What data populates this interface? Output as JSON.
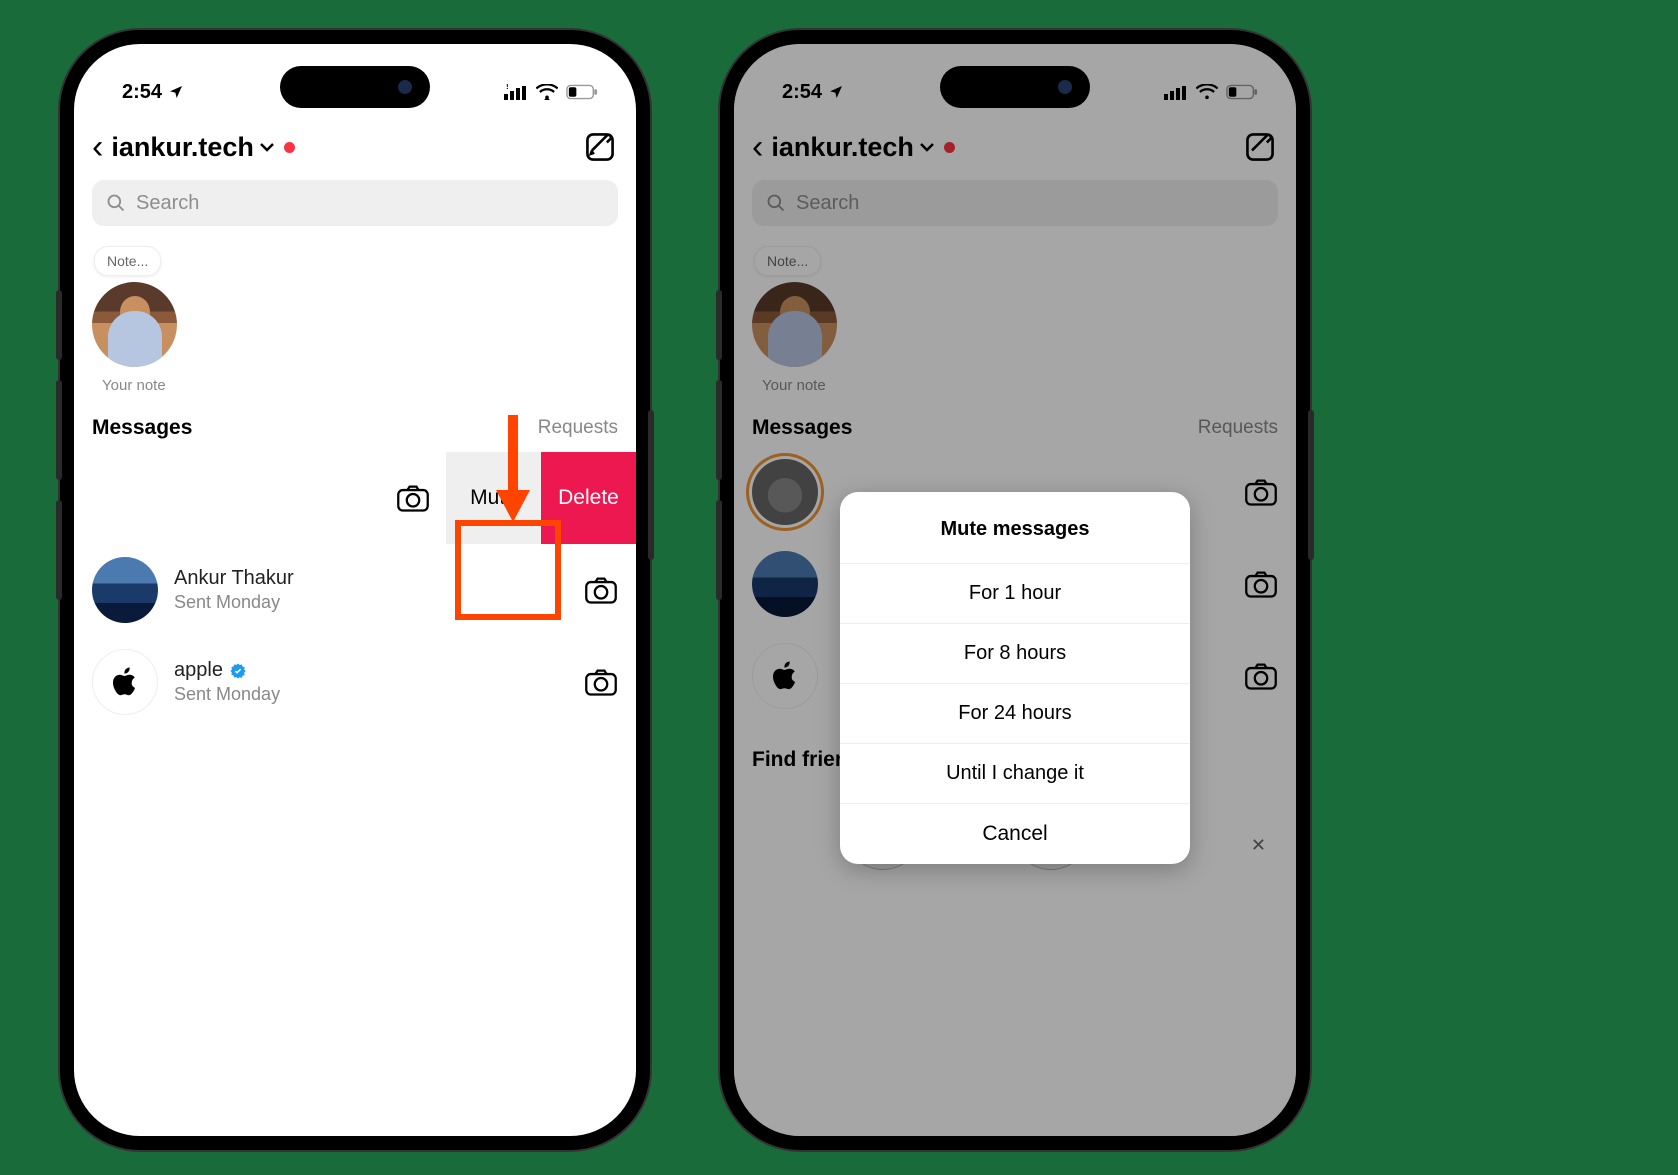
{
  "status": {
    "time": "2:54",
    "signal": "●●●●",
    "wifi": true,
    "battery": "low"
  },
  "header": {
    "username": "iankur.tech"
  },
  "search": {
    "placeholder": "Search"
  },
  "note": {
    "bubble": "Note...",
    "label": "Your note"
  },
  "sections": {
    "messages": "Messages",
    "requests": "Requests"
  },
  "swipe": {
    "mute": "Mute",
    "delete": "Delete"
  },
  "messages": [
    {
      "name": "Ankur Thakur",
      "sub": "Sent Monday",
      "verified": false
    },
    {
      "name": "apple",
      "sub": "Sent Monday",
      "verified": true
    }
  ],
  "find": {
    "title": "Find friends"
  },
  "sheet": {
    "title": "Mute messages",
    "options": [
      "For 1 hour",
      "For 8 hours",
      "For 24 hours",
      "Until I change it"
    ],
    "cancel": "Cancel"
  }
}
